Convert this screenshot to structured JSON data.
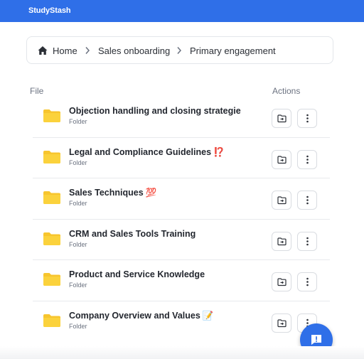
{
  "app": {
    "brand": "StudyStash",
    "accent_color": "#2f6fe8"
  },
  "breadcrumb": {
    "icon": "home-icon",
    "items": [
      "Home",
      "Sales onboarding",
      "Primary engagement"
    ]
  },
  "table": {
    "headers": {
      "file": "File",
      "actions": "Actions"
    },
    "rows": [
      {
        "name": "Objection handling and closing strategie",
        "emoji": "",
        "type": "Folder"
      },
      {
        "name": "Legal and Compliance Guidelines",
        "emoji": "⁉️",
        "type": "Folder"
      },
      {
        "name": "Sales Techniques",
        "emoji": "💯",
        "type": "Folder"
      },
      {
        "name": "CRM and Sales Tools Training",
        "emoji": "",
        "type": "Folder"
      },
      {
        "name": "Product and Service Knowledge",
        "emoji": "",
        "type": "Folder"
      },
      {
        "name": "Company Overview and Values",
        "emoji": "📝",
        "type": "Folder"
      }
    ],
    "row_icon": "folder-icon",
    "action_icons": [
      "folder-move-icon",
      "more-vertical-icon"
    ]
  },
  "fab": {
    "icon": "chat-alert-icon"
  }
}
